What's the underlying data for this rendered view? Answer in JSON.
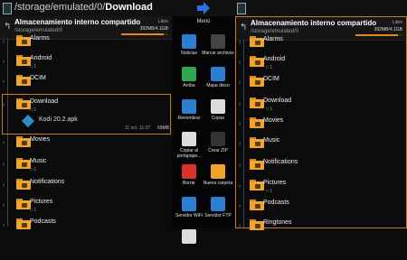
{
  "top": {
    "path_prefix": "/storage/emulated/0/",
    "path_current": "Download"
  },
  "left": {
    "title": "Almacenamiento interno compartido",
    "subtitle": "/storage/emulated/0",
    "free_label": "Libre",
    "size_label": "392MB/4.1GB",
    "usage_fraction": 0.9,
    "items": [
      {
        "label": "Alarms",
        "count": ""
      },
      {
        "label": "Android",
        "count": "□ 1"
      },
      {
        "label": "DCIM",
        "count": ""
      },
      {
        "label": "Download",
        "count": "□ 1"
      },
      {
        "label": "Movies",
        "count": ""
      },
      {
        "label": "Music",
        "count": "□ 1"
      },
      {
        "label": "Notifications",
        "count": ""
      },
      {
        "label": "Pictures",
        "count": "□ 1"
      },
      {
        "label": "Podcasts",
        "count": ""
      }
    ],
    "file": {
      "name": "Kodi 20.2.apk",
      "time": "11 oct. 11:37",
      "size": "69MB"
    }
  },
  "menu": {
    "title": "Menú",
    "items": [
      {
        "label": "Noticias",
        "icon": "settings-icon",
        "color": "#2b7fd1"
      },
      {
        "label": "Marcar archivos",
        "icon": "check-icon",
        "color": "#444"
      },
      {
        "label": "Arriba",
        "icon": "up-arrow-icon",
        "color": "#2fa84f"
      },
      {
        "label": "Mapa disco",
        "icon": "pie-chart-icon",
        "color": "#2b7fd1"
      },
      {
        "label": "Renombrar",
        "icon": "rename-icon",
        "color": "#2b7fd1"
      },
      {
        "label": "Copiar",
        "icon": "copy-icon",
        "color": "#dcdcdc"
      },
      {
        "label": "Copiar al portapape...",
        "icon": "clipboard-icon",
        "color": "#dcdcdc"
      },
      {
        "label": "Crear ZIP",
        "icon": "zip-icon",
        "color": "#333"
      },
      {
        "label": "Borrar",
        "icon": "trash-icon",
        "color": "#d9342b"
      },
      {
        "label": "Nueva carpeta",
        "icon": "new-folder-icon",
        "color": "#f0a62c"
      },
      {
        "label": "Servidor WiFi",
        "icon": "wifi-icon",
        "color": "#2b7fd1"
      },
      {
        "label": "Servidor FTP",
        "icon": "ftp-icon",
        "color": "#2b7fd1"
      },
      {
        "label": "",
        "icon": "sort-icon",
        "color": "#ddd"
      }
    ]
  },
  "right": {
    "title": "Almacenamiento interno compartido",
    "subtitle": "/storage/emulated/0",
    "free_label": "Libre",
    "size_label": "392MB/4.1GB",
    "usage_fraction": 0.9,
    "items": [
      {
        "label": "Alarms",
        "count": ""
      },
      {
        "label": "Android",
        "count": "□ 1"
      },
      {
        "label": "DCIM",
        "count": ""
      },
      {
        "label": "Download",
        "count": "□ 1"
      },
      {
        "label": "Movies",
        "count": ""
      },
      {
        "label": "Music",
        "count": ""
      },
      {
        "label": "Notifications",
        "count": ""
      },
      {
        "label": "Pictures",
        "count": "□ 1"
      },
      {
        "label": "Podcasts",
        "count": ""
      },
      {
        "label": "Ringtones",
        "count": ""
      }
    ]
  }
}
